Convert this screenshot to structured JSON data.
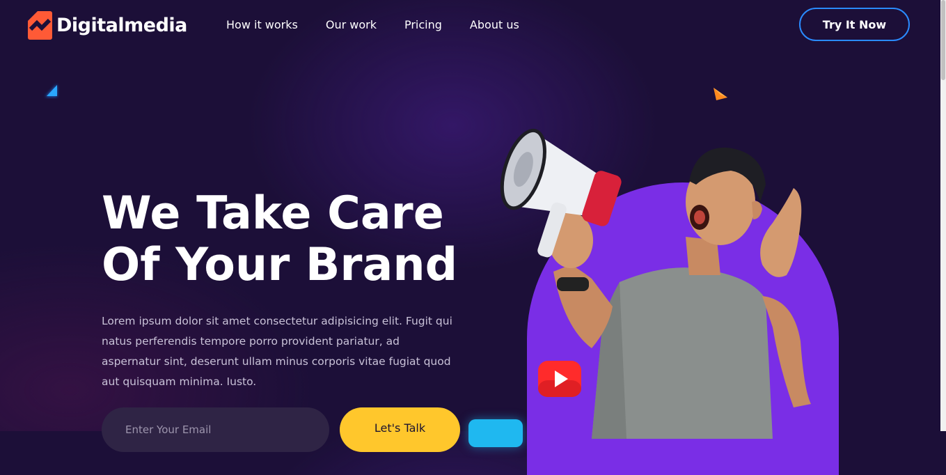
{
  "brand": {
    "name": "Digitalmedia",
    "logo_color": "#ff5a36"
  },
  "nav": {
    "items": [
      {
        "label": "How it works"
      },
      {
        "label": "Our work"
      },
      {
        "label": "Pricing"
      },
      {
        "label": "About us"
      }
    ]
  },
  "header": {
    "cta_label": "Try It Now"
  },
  "hero": {
    "title_line1": "We Take Care",
    "title_line2": "Of Your Brand",
    "description": "Lorem ipsum dolor sit amet consectetur adipisicing elit. Fugit qui natus perferendis tempore porro provident pariatur, ad aspernatur sint, deserunt ullam minus corporis vitae fugiat quod aut quisquam minima. Iusto.",
    "email_placeholder": "Enter Your Email",
    "submit_label": "Let's Talk"
  },
  "colors": {
    "background": "#1c0f38",
    "accent_blue": "#2a8bff",
    "accent_yellow": "#ffc72c",
    "accent_purple": "#7a2ee6",
    "youtube_red": "#ff2b2b"
  },
  "icons": [
    "logo-icon",
    "triangle-blue-icon",
    "triangle-orange-icon",
    "youtube-icon",
    "megaphone-man-illustration"
  ]
}
